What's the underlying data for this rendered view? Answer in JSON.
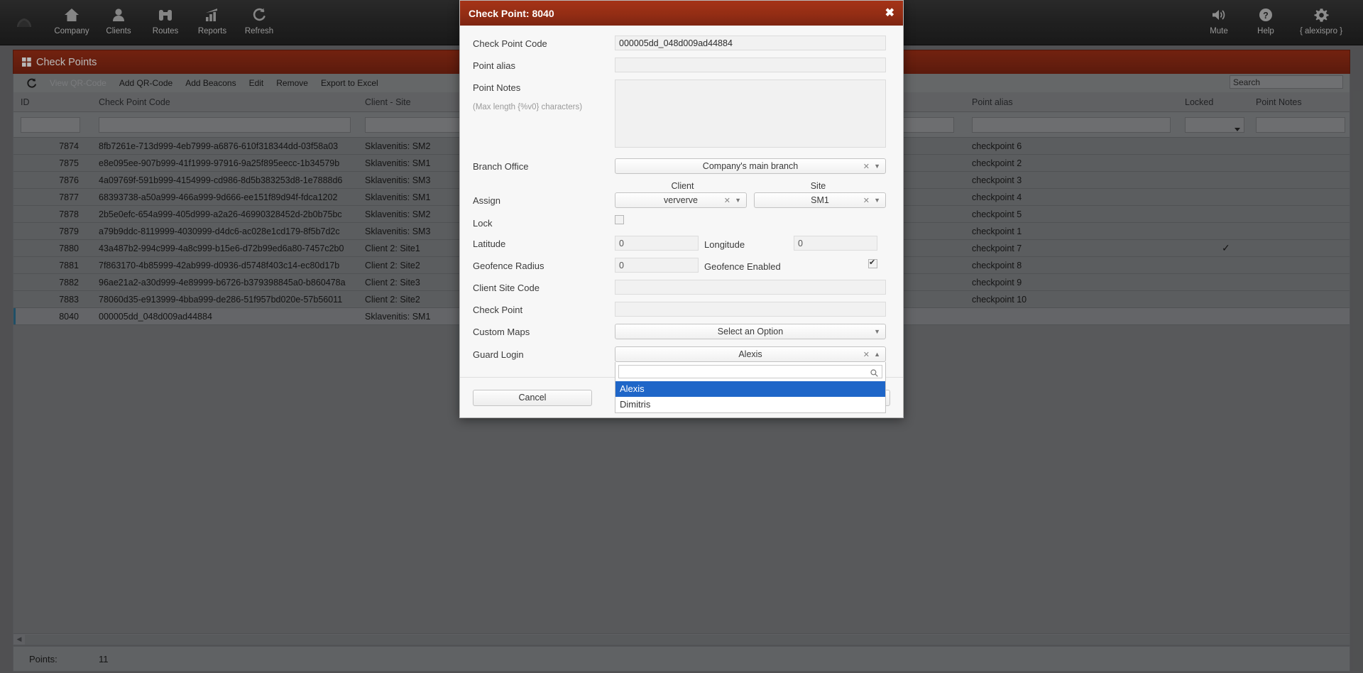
{
  "topnav": {
    "left_items": [
      {
        "label": "Company",
        "icon": "home-icon"
      },
      {
        "label": "Clients",
        "icon": "user-icon"
      },
      {
        "label": "Routes",
        "icon": "binoculars-icon"
      },
      {
        "label": "Reports",
        "icon": "bar-chart-icon"
      },
      {
        "label": "Refresh",
        "icon": "refresh-icon"
      }
    ],
    "right_items": [
      {
        "label": "Mute",
        "icon": "speaker-icon"
      },
      {
        "label": "Help",
        "icon": "question-circle-icon"
      },
      {
        "label": "{ alexispro }",
        "icon": "gear-icon"
      }
    ]
  },
  "panel": {
    "title": "Check Points",
    "toolbar": {
      "refresh_icon": "refresh-icon",
      "buttons": [
        {
          "label": "View QR-Code",
          "disabled": true
        },
        {
          "label": "Add QR-Code",
          "disabled": false
        },
        {
          "label": "Add Beacons",
          "disabled": false
        },
        {
          "label": "Edit",
          "disabled": false
        },
        {
          "label": "Remove",
          "disabled": false
        },
        {
          "label": "Export to Excel",
          "disabled": false
        }
      ]
    },
    "search": {
      "placeholder": "",
      "value": "Search"
    }
  },
  "grid": {
    "columns": [
      "ID",
      "Check Point Code",
      "Client - Site",
      "Point alias",
      "Locked",
      "Point Notes"
    ],
    "filters": {
      "id": "",
      "code": "",
      "client_site": "",
      "middle": "",
      "alias": "",
      "locked": "",
      "notes": ""
    },
    "rows": [
      {
        "id": "7874",
        "code": "8fb7261e-713d999-4eb7999-a6876-610f318344dd-03f58a03",
        "client_site": "Sklavenitis: SM2",
        "alias": "checkpoint 6",
        "locked": "",
        "notes": ""
      },
      {
        "id": "7875",
        "code": "e8e095ee-907b999-41f1999-97916-9a25f895eecc-1b34579b",
        "client_site": "Sklavenitis: SM1",
        "alias": "checkpoint 2",
        "locked": "",
        "notes": ""
      },
      {
        "id": "7876",
        "code": "4a09769f-591b999-4154999-cd986-8d5b383253d8-1e7888d6",
        "client_site": "Sklavenitis: SM3",
        "alias": "checkpoint 3",
        "locked": "",
        "notes": ""
      },
      {
        "id": "7877",
        "code": "68393738-a50a999-466a999-9d666-ee151f89d94f-fdca1202",
        "client_site": "Sklavenitis: SM1",
        "alias": "checkpoint 4",
        "locked": "",
        "notes": ""
      },
      {
        "id": "7878",
        "code": "2b5e0efc-654a999-405d999-a2a26-46990328452d-2b0b75bc",
        "client_site": "Sklavenitis: SM2",
        "alias": "checkpoint 5",
        "locked": "",
        "notes": ""
      },
      {
        "id": "7879",
        "code": "a79b9ddc-8119999-4030999-d4dc6-ac028e1cd179-8f5b7d2c",
        "client_site": "Sklavenitis: SM3",
        "alias": "checkpoint 1",
        "locked": "",
        "notes": ""
      },
      {
        "id": "7880",
        "code": "43a487b2-994c999-4a8c999-b15e6-d72b99ed6a80-7457c2b0",
        "client_site": "Client 2: Site1",
        "alias": "checkpoint 7",
        "locked": "✓",
        "notes": ""
      },
      {
        "id": "7881",
        "code": "7f863170-4b85999-42ab999-d0936-d5748f403c14-ec80d17b",
        "client_site": "Client 2: Site2",
        "alias": "checkpoint 8",
        "locked": "",
        "notes": ""
      },
      {
        "id": "7882",
        "code": "96ae21a2-a30d999-4e89999-b6726-b379398845a0-b860478a",
        "client_site": "Client 2: Site3",
        "alias": "checkpoint 9",
        "locked": "",
        "notes": ""
      },
      {
        "id": "7883",
        "code": "78060d35-e913999-4bba999-de286-51f957bd020e-57b56011",
        "client_site": "Client 2: Site2",
        "alias": "checkpoint 10",
        "locked": "",
        "notes": ""
      },
      {
        "id": "8040",
        "code": "000005dd_048d009ad44884",
        "client_site": "Sklavenitis: SM1",
        "alias": "",
        "locked": "",
        "notes": "",
        "selected": true
      }
    ]
  },
  "statusbar": {
    "points_label": "Points:",
    "points_value": "11"
  },
  "modal": {
    "title": "Check Point: 8040",
    "close_label": "✖",
    "fields": {
      "check_point_code_label": "Check Point Code",
      "check_point_code_value": "000005dd_048d009ad44884",
      "point_alias_label": "Point alias",
      "point_alias_value": "",
      "point_notes_label": "Point Notes",
      "point_notes_value": "",
      "point_notes_hint": "(Max length {%v0} characters)",
      "branch_office_label": "Branch Office",
      "branch_office_value": "Company's main branch",
      "assign_label": "Assign",
      "assign_client_header": "Client",
      "assign_site_header": "Site",
      "assign_client_value": "ververve",
      "assign_site_value": "SM1",
      "lock_label": "Lock",
      "lock_checked": false,
      "latitude_label": "Latitude",
      "latitude_value": "0",
      "longitude_label": "Longitude",
      "longitude_value": "0",
      "geofence_radius_label": "Geofence Radius",
      "geofence_radius_value": "0",
      "geofence_enabled_label": "Geofence Enabled",
      "geofence_enabled_checked": true,
      "client_site_code_label": "Client Site Code",
      "client_site_code_value": "",
      "check_point_label": "Check Point",
      "check_point_value": "",
      "custom_maps_label": "Custom Maps",
      "custom_maps_value": "Select an Option",
      "guard_login_label": "Guard Login",
      "guard_login_value": "Alexis"
    },
    "guard_dropdown": {
      "search_value": "",
      "search_icon": "search-icon",
      "options": [
        {
          "label": "Alexis",
          "highlighted": true
        },
        {
          "label": "Dimitris",
          "highlighted": false
        }
      ]
    },
    "footer": {
      "cancel_label": "Cancel",
      "save_label": ""
    }
  },
  "colors": {
    "brand_red": "#8c2a14",
    "accent_blue": "#1f66c8",
    "selected_row_mark": "#2d6e8e"
  }
}
